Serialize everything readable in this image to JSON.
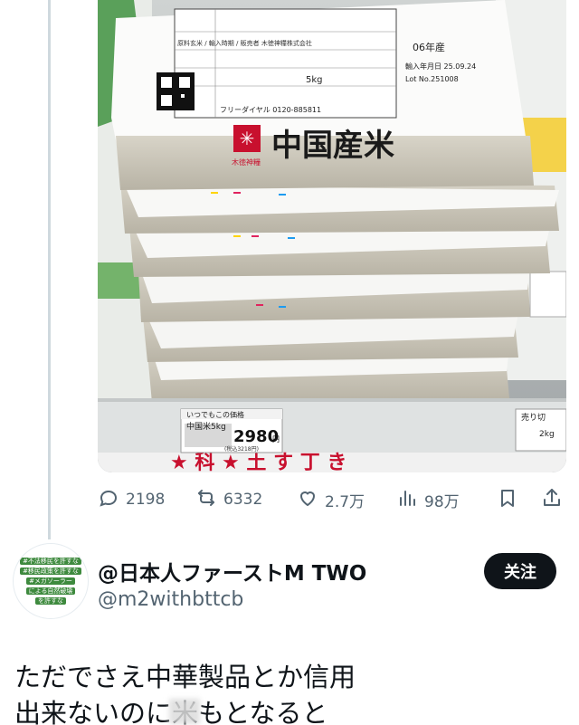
{
  "photo": {
    "bag_label_main": "中国産米",
    "bag_label_top": "*",
    "bag_label_sub": "木徳神糧",
    "bag_year": "06年産",
    "bag_import_date": "輸入年月日 25.09.24",
    "bag_lot": "Lot No.251008",
    "bag_weight": "5kg",
    "bag_details": "原料玄米 / 輸入時期 / 販売者 木徳神糧株式会社",
    "bag_phone": "フリーダイヤル 0120-885811",
    "price_tag_title": "いつでもこの価格",
    "price_tag_product": "中国米5kg",
    "price_tag_price": "2980",
    "price_tag_price_unit": "円",
    "price_tag_taxed": "(税込3218円)",
    "side_tag_title": "売り切",
    "side_tag_weight": "2kg"
  },
  "actions": {
    "reply_count": "2198",
    "retweet_count": "6332",
    "like_count": "2.7万",
    "view_count": "98万"
  },
  "author": {
    "display_name": "@日本人ファーストM TWO",
    "handle": "@m2withbttcb",
    "follow_label": "关注",
    "avatar_lines": [
      "#不法移民を許すな",
      "#移民政策を許すな",
      "#メガソーラー",
      "による自然破壊",
      "を許すな"
    ]
  },
  "tweet": {
    "text": "ただでさえ中華製品とか信用\n出来ないのに米もとなると"
  },
  "colors": {
    "accent": "#0f1419",
    "muted": "#536471",
    "avatar_green": "#3e8a3e",
    "price_red": "#c8102e"
  }
}
